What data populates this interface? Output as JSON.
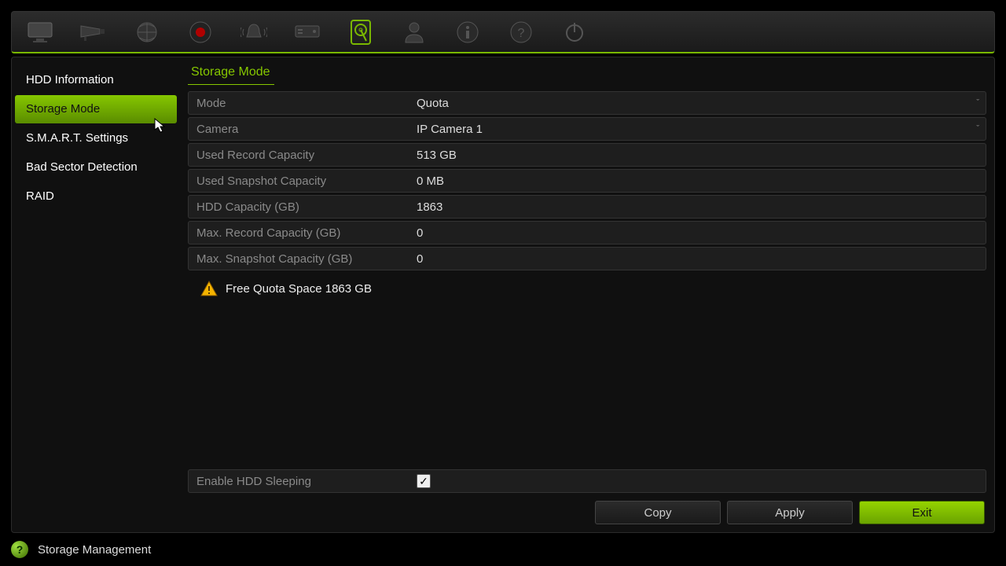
{
  "sidebar": {
    "items": [
      {
        "label": "HDD Information"
      },
      {
        "label": "Storage Mode"
      },
      {
        "label": "S.M.A.R.T. Settings"
      },
      {
        "label": "Bad Sector Detection"
      },
      {
        "label": "RAID"
      }
    ],
    "activeIndex": 1
  },
  "page": {
    "title": "Storage Mode"
  },
  "form": {
    "mode_label": "Mode",
    "mode_value": "Quota",
    "camera_label": "Camera",
    "camera_value": "IP Camera 1",
    "used_record_label": "Used Record Capacity",
    "used_record_value": "513 GB",
    "used_snapshot_label": "Used Snapshot Capacity",
    "used_snapshot_value": "0 MB",
    "hdd_capacity_label": "HDD Capacity (GB)",
    "hdd_capacity_value": "1863",
    "max_record_label": "Max. Record Capacity (GB)",
    "max_record_value": "0",
    "max_snapshot_label": "Max. Snapshot Capacity (GB)",
    "max_snapshot_value": "0",
    "free_quota": "Free Quota Space 1863 GB",
    "sleep_label": "Enable HDD Sleeping",
    "sleep_checked": true
  },
  "buttons": {
    "copy": "Copy",
    "apply": "Apply",
    "exit": "Exit"
  },
  "footer": {
    "title": "Storage Management"
  }
}
